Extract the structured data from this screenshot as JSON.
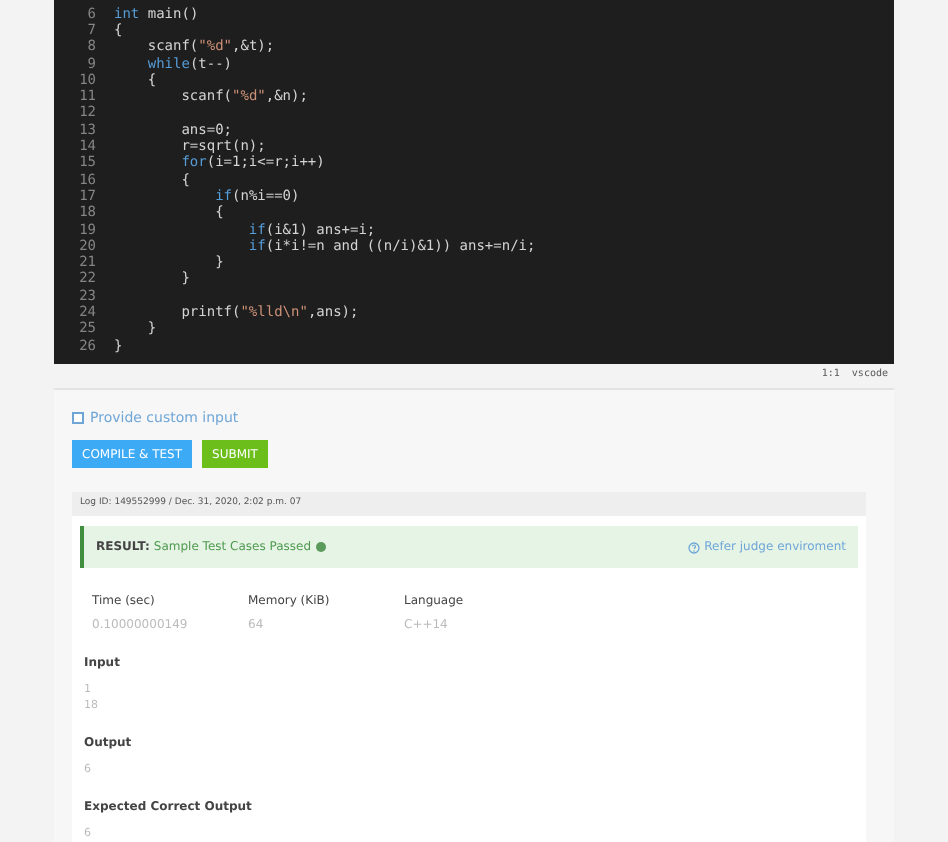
{
  "editor": {
    "lines": [
      {
        "number": "6",
        "tokens": [
          {
            "kind": "keyword",
            "text": "int"
          },
          {
            "kind": "plain",
            "text": " main()"
          }
        ]
      },
      {
        "number": "7",
        "tokens": [
          {
            "kind": "plain",
            "text": "{"
          }
        ]
      },
      {
        "number": "8",
        "tokens": [
          {
            "kind": "plain",
            "text": "    scanf("
          },
          {
            "kind": "string",
            "text": "\"%d\""
          },
          {
            "kind": "plain",
            "text": ",&t);"
          }
        ]
      },
      {
        "number": "9",
        "tokens": [
          {
            "kind": "keyword",
            "text": "    while"
          },
          {
            "kind": "plain",
            "text": "(t--)"
          }
        ]
      },
      {
        "number": "10",
        "tokens": [
          {
            "kind": "plain",
            "text": "    {"
          }
        ]
      },
      {
        "number": "11",
        "tokens": [
          {
            "kind": "plain",
            "text": "        scanf("
          },
          {
            "kind": "string",
            "text": "\"%d\""
          },
          {
            "kind": "plain",
            "text": ",&n);"
          }
        ]
      },
      {
        "number": "12"
      },
      {
        "number": "13",
        "tokens": [
          {
            "kind": "plain",
            "text": "        ans=0;"
          }
        ]
      },
      {
        "number": "14",
        "tokens": [
          {
            "kind": "plain",
            "text": "        r=sqrt(n);"
          }
        ]
      },
      {
        "number": "15",
        "tokens": [
          {
            "kind": "keyword",
            "text": "        for"
          },
          {
            "kind": "plain",
            "text": "(i=1;i<=r;i++)"
          }
        ]
      },
      {
        "number": "16",
        "tokens": [
          {
            "kind": "plain",
            "text": "        {"
          }
        ]
      },
      {
        "number": "17",
        "tokens": [
          {
            "kind": "keyword",
            "text": "            if"
          },
          {
            "kind": "plain",
            "text": "(n%i==0)"
          }
        ]
      },
      {
        "number": "18",
        "tokens": [
          {
            "kind": "plain",
            "text": "            {"
          }
        ]
      },
      {
        "number": "19",
        "tokens": [
          {
            "kind": "keyword",
            "text": "                if"
          },
          {
            "kind": "plain",
            "text": "(i&1) ans+=i;"
          }
        ]
      },
      {
        "number": "20",
        "tokens": [
          {
            "kind": "keyword",
            "text": "                if"
          },
          {
            "kind": "plain",
            "text": "(i*i!=n and ((n/i)&1)) ans+=n/i;"
          }
        ]
      },
      {
        "number": "21",
        "tokens": [
          {
            "kind": "plain",
            "text": "            }"
          }
        ]
      },
      {
        "number": "22",
        "tokens": [
          {
            "kind": "plain",
            "text": "        }"
          }
        ]
      },
      {
        "number": "23"
      },
      {
        "number": "24",
        "tokens": [
          {
            "kind": "plain",
            "text": "        printf("
          },
          {
            "kind": "string",
            "text": "\"%lld\\n\""
          },
          {
            "kind": "plain",
            "text": ",ans);"
          }
        ]
      },
      {
        "number": "25",
        "tokens": [
          {
            "kind": "plain",
            "text": "    }"
          }
        ]
      },
      {
        "number": "26",
        "tokens": [
          {
            "kind": "plain",
            "text": "}"
          }
        ]
      }
    ]
  },
  "editor_status": "1:1  vscode",
  "custom_input": {
    "label": "Provide custom input",
    "checked": false
  },
  "buttons": [
    {
      "label": "COMPILE & TEST",
      "kind": "compile"
    },
    {
      "label": "SUBMIT",
      "kind": "submit"
    }
  ],
  "log": {
    "header": "Log ID: 149552999 / Dec. 31, 2020, 2:02 p.m. 07",
    "result": {
      "label": "RESULT:",
      "status": "Sample Test Cases Passed",
      "link": "Refer judge enviroment"
    },
    "stats": [
      {
        "label": "Time (sec)",
        "value": "0.10000000149"
      },
      {
        "label": "Memory (KiB)",
        "value": "64"
      },
      {
        "label": "Language",
        "value": "C++14"
      }
    ],
    "sections": [
      {
        "title": "Input",
        "lines": [
          "1",
          "18"
        ]
      },
      {
        "title": "Output",
        "lines": [
          "6"
        ]
      },
      {
        "title": "Expected Correct Output",
        "lines": [
          "6"
        ]
      }
    ]
  }
}
